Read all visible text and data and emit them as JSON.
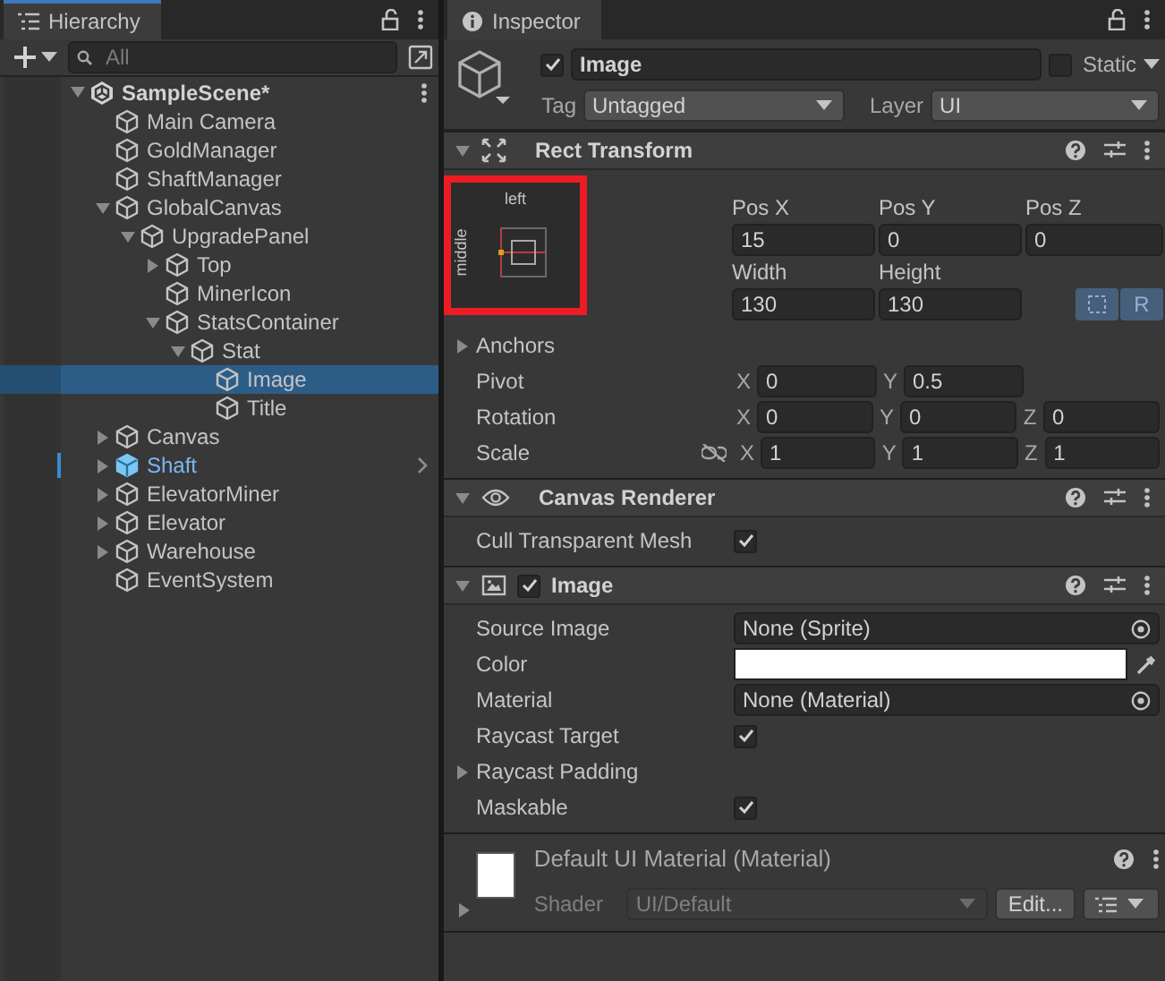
{
  "hierarchy": {
    "title": "Hierarchy",
    "focused": true,
    "search": {
      "placeholder": "All"
    },
    "scene": {
      "name": "SampleScene*",
      "expanded": true,
      "children": [
        {
          "name": "Main Camera",
          "kind": "object",
          "selected": false
        },
        {
          "name": "GoldManager",
          "kind": "object",
          "selected": false
        },
        {
          "name": "ShaftManager",
          "kind": "object",
          "selected": false
        },
        {
          "name": "GlobalCanvas",
          "kind": "object",
          "selected": false,
          "expanded": true,
          "children": [
            {
              "name": "UpgradePanel",
              "kind": "object",
              "selected": false,
              "expanded": true,
              "children": [
                {
                  "name": "Top",
                  "kind": "object",
                  "selected": false,
                  "expanded": false
                },
                {
                  "name": "MinerIcon",
                  "kind": "object",
                  "selected": false
                },
                {
                  "name": "StatsContainer",
                  "kind": "object",
                  "selected": false,
                  "expanded": true,
                  "children": [
                    {
                      "name": "Stat",
                      "kind": "object",
                      "selected": false,
                      "expanded": true,
                      "children": [
                        {
                          "name": "Image",
                          "kind": "object",
                          "selected": true
                        },
                        {
                          "name": "Title",
                          "kind": "object",
                          "selected": false
                        }
                      ]
                    }
                  ]
                }
              ]
            }
          ]
        },
        {
          "name": "Canvas",
          "kind": "object",
          "selected": false,
          "expanded": false
        },
        {
          "name": "Shaft",
          "kind": "prefab",
          "selected": false,
          "expanded": false
        },
        {
          "name": "ElevatorMiner",
          "kind": "object",
          "selected": false,
          "expanded": false
        },
        {
          "name": "Elevator",
          "kind": "object",
          "selected": false,
          "expanded": false
        },
        {
          "name": "Warehouse",
          "kind": "object",
          "selected": false,
          "expanded": false
        },
        {
          "name": "EventSystem",
          "kind": "object",
          "selected": false
        }
      ]
    }
  },
  "inspector": {
    "title": "Inspector",
    "focused": false,
    "object": {
      "active": true,
      "name": "Image",
      "static": false,
      "static_label": "Static",
      "tag_label": "Tag",
      "tag": "Untagged",
      "layer_label": "Layer",
      "layer": "UI"
    },
    "components": [
      {
        "kind": "rect_transform",
        "title": "Rect Transform",
        "expanded": true,
        "anchor": {
          "horizontal": "left",
          "vertical": "middle",
          "highlighted": true
        },
        "fields": [
          {
            "label": "Pos X",
            "value": "15"
          },
          {
            "label": "Pos Y",
            "value": "0"
          },
          {
            "label": "Pos Z",
            "value": "0"
          },
          {
            "label": "Width",
            "value": "130"
          },
          {
            "label": "Height",
            "value": "130"
          }
        ],
        "modes": [
          {
            "kind": "blueprint",
            "on": true
          },
          {
            "kind": "raw",
            "label": "R",
            "on": true
          }
        ],
        "rows": [
          {
            "kind": "foldout",
            "label": "Anchors",
            "expanded": false
          },
          {
            "kind": "vector",
            "label": "Pivot",
            "axes": [
              {
                "axis": "X",
                "value": "0"
              },
              {
                "axis": "Y",
                "value": "0.5"
              }
            ]
          },
          {
            "kind": "vector",
            "label": "Rotation",
            "axes": [
              {
                "axis": "X",
                "value": "0"
              },
              {
                "axis": "Y",
                "value": "0"
              },
              {
                "axis": "Z",
                "value": "0"
              }
            ]
          },
          {
            "kind": "vector",
            "label": "Scale",
            "linked": false,
            "axes": [
              {
                "axis": "X",
                "value": "1"
              },
              {
                "axis": "Y",
                "value": "1"
              },
              {
                "axis": "Z",
                "value": "1"
              }
            ]
          }
        ]
      },
      {
        "kind": "canvas_renderer",
        "title": "Canvas Renderer",
        "expanded": true,
        "rows": [
          {
            "kind": "checkbox",
            "label": "Cull Transparent Mesh",
            "checked": true
          }
        ]
      },
      {
        "kind": "image",
        "title": "Image",
        "expanded": true,
        "enabled": true,
        "rows": [
          {
            "kind": "object",
            "label": "Source Image",
            "value": "None (Sprite)"
          },
          {
            "kind": "color",
            "label": "Color",
            "color": "#ffffff"
          },
          {
            "kind": "object",
            "label": "Material",
            "value": "None (Material)"
          },
          {
            "kind": "checkbox",
            "label": "Raycast Target",
            "checked": true
          },
          {
            "kind": "foldout",
            "label": "Raycast Padding",
            "expanded": false
          },
          {
            "kind": "checkbox",
            "label": "Maskable",
            "checked": true
          }
        ]
      },
      {
        "kind": "material",
        "title": "Default UI Material (Material)",
        "expanded": false,
        "color": "#ffffff",
        "shader_label": "Shader",
        "shader": "UI/Default",
        "edit_button": "Edit..."
      }
    ]
  }
}
